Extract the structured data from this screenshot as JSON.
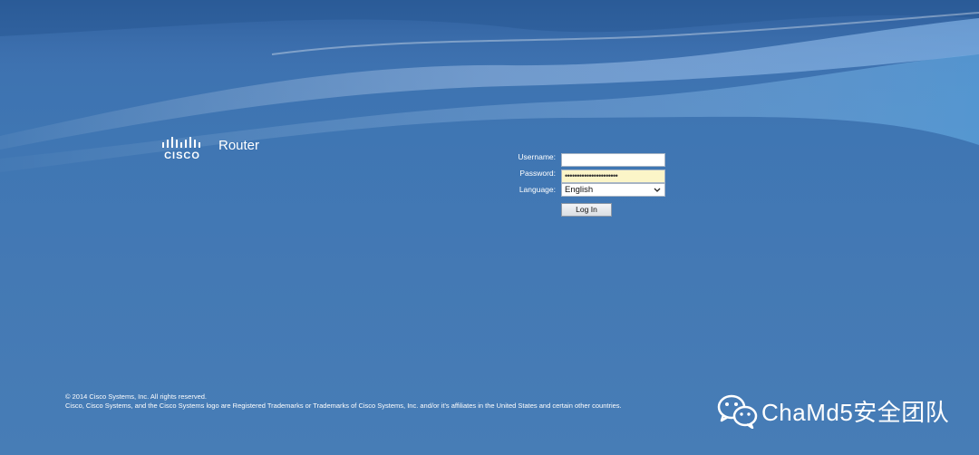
{
  "brand": {
    "logo_wordmark": "CISCO",
    "product_name": "Router"
  },
  "login": {
    "username_label": "Username:",
    "username_value": "",
    "password_label": "Password:",
    "password_value": "••••••••••••••••••••••",
    "language_label": "Language:",
    "language_selected": "English",
    "login_button_label": "Log In"
  },
  "footer": {
    "copyright": "© 2014 Cisco Systems, Inc. All rights reserved.",
    "trademark": "Cisco, Cisco Systems, and the Cisco Systems logo are Registered Trademarks or Trademarks of Cisco Systems, Inc. and/or it's affiliates in the United States and certain other countries."
  },
  "watermark": {
    "text": "ChaMd5安全团队",
    "icon": "wechat-icon"
  },
  "colors": {
    "background": "#4479b4",
    "password_field": "#fbf5c8",
    "text": "#ffffff"
  }
}
